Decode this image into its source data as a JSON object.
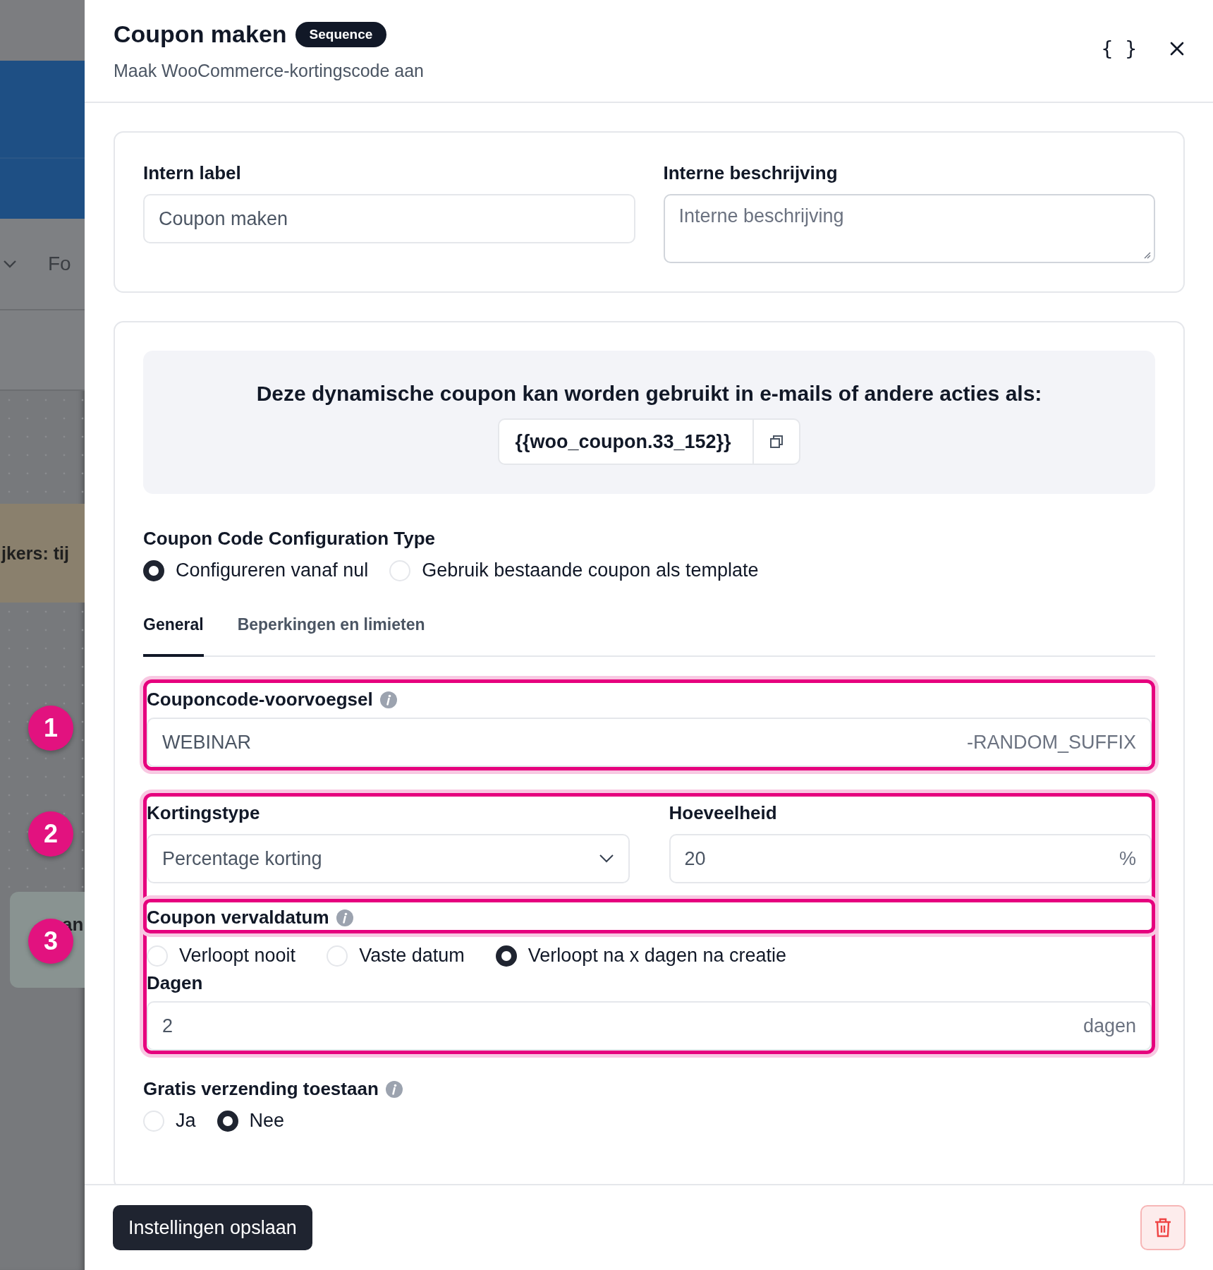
{
  "backdrop": {
    "row_text": "Fo",
    "banner_text": "jkers: tij",
    "card_title": "an",
    "step_badges": [
      "1",
      "2",
      "3"
    ]
  },
  "panel": {
    "title": "Coupon maken",
    "tag": "Sequence",
    "subtitle": "Maak WooCommerce-kortingscode aan",
    "code_toggle": "{ }"
  },
  "internal": {
    "label_field": {
      "label": "Intern label",
      "value": "Coupon maken"
    },
    "description_field": {
      "label": "Interne beschrijving",
      "placeholder": "Interne beschrijving"
    }
  },
  "coupon_info": {
    "heading": "Deze dynamische coupon kan worden gebruikt in e-mails of andere acties als:",
    "code": "{{woo_coupon.33_152}}"
  },
  "config_type": {
    "label": "Coupon Code Configuration Type",
    "options": [
      {
        "label": "Configureren vanaf nul",
        "selected": true
      },
      {
        "label": "Gebruik bestaande coupon als template",
        "selected": false
      }
    ]
  },
  "tabs": [
    {
      "label": "General",
      "selected": true
    },
    {
      "label": "Beperkingen en limieten",
      "selected": false
    }
  ],
  "prefix": {
    "label": "Couponcode-voorvoegsel",
    "value": "WEBINAR",
    "suffix": "-RANDOM_SUFFIX",
    "highlighted": true
  },
  "discount": {
    "highlighted": true,
    "type": {
      "label": "Kortingstype",
      "value": "Percentage korting"
    },
    "amount": {
      "label": "Hoeveelheid",
      "value": "20",
      "suffix": "%"
    }
  },
  "expiry": {
    "label": "Coupon vervaldatum",
    "label_highlighted": true,
    "options": [
      {
        "label": "Verloopt nooit",
        "selected": false
      },
      {
        "label": "Vaste datum",
        "selected": false
      },
      {
        "label": "Verloopt na x dagen na creatie",
        "selected": true
      }
    ],
    "days": {
      "label": "Dagen",
      "value": "2",
      "suffix": "dagen"
    }
  },
  "free_shipping": {
    "label": "Gratis verzending toestaan",
    "options": [
      {
        "label": "Ja",
        "selected": false
      },
      {
        "label": "Nee",
        "selected": true
      }
    ]
  },
  "footer": {
    "save_button": "Instellingen opslaan"
  }
}
